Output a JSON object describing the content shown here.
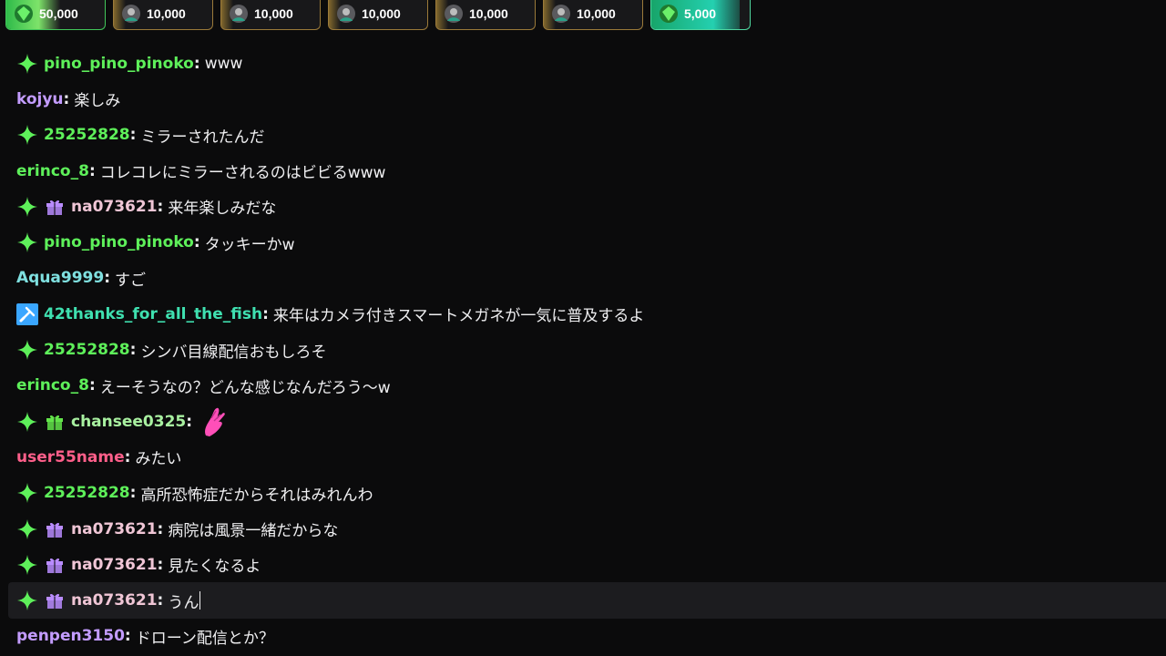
{
  "leaderboard": [
    {
      "amount": "50,000",
      "icon": "green-gem-avatar-icon",
      "fill_ratio": 0.55
    },
    {
      "amount": "10,000",
      "icon": "avatar-icon",
      "fill_ratio": 0.12
    },
    {
      "amount": "10,000",
      "icon": "avatar-icon",
      "fill_ratio": 0.12
    },
    {
      "amount": "10,000",
      "icon": "avatar-icon",
      "fill_ratio": 0.12
    },
    {
      "amount": "10,000",
      "icon": "avatar-icon",
      "fill_ratio": 0.12
    },
    {
      "amount": "10,000",
      "icon": "avatar-icon",
      "fill_ratio": 0.12
    },
    {
      "amount": "5,000",
      "icon": "green-gem-avatar-icon",
      "fill_ratio": 0.9
    }
  ],
  "colors": {
    "background": "#0b0b0c",
    "green": "#5ef05a",
    "purple": "#c39cff",
    "cyan": "#7fe0e0",
    "pink": "#ff5fa8",
    "gift_purple": "#b98cff",
    "gift_green": "#63e44a",
    "badge_green": "#5ef05a",
    "mod_blue": "#3aa6ff"
  },
  "chat": {
    "messages": [
      {
        "user": "pino_pino_pinoko",
        "color": "#5ef05a",
        "badges": [
          "sparkle-badge-icon"
        ],
        "text": "www"
      },
      {
        "user": "kojyu",
        "color": "#c39cff",
        "badges": [],
        "text": "楽しみ"
      },
      {
        "user": "25252828",
        "color": "#5ef05a",
        "badges": [
          "sparkle-badge-icon"
        ],
        "text": "ミラーされたんだ"
      },
      {
        "user": "erinco_8",
        "color": "#5ef05a",
        "badges": [],
        "text": "コレコレにミラーされるのはビビるwww"
      },
      {
        "user": "na073621",
        "color": "#f0c6d6",
        "badges": [
          "sparkle-badge-icon",
          "gift-purple-badge-icon"
        ],
        "text": "来年楽しみだな"
      },
      {
        "user": "pino_pino_pinoko",
        "color": "#5ef05a",
        "badges": [
          "sparkle-badge-icon"
        ],
        "text": "タッキーかw"
      },
      {
        "user": "Aqua9999",
        "color": "#7fe0e0",
        "badges": [],
        "text": "すご"
      },
      {
        "user": "42thanks_for_all_the_fish",
        "color": "#3fe0b0",
        "badges": [
          "moderator-sword-badge-icon"
        ],
        "text": "来年はカメラ付きスマートメガネが一気に普及するよ"
      },
      {
        "user": "25252828",
        "color": "#5ef05a",
        "badges": [
          "sparkle-badge-icon"
        ],
        "text": "シンバ目線配信おもしろそ"
      },
      {
        "user": "erinco_8",
        "color": "#5ef05a",
        "badges": [],
        "text": "えーそうなの？どんな感じなんだろう〜w"
      },
      {
        "user": "chansee0325",
        "color": "#a8f0a0",
        "badges": [
          "sparkle-badge-icon",
          "gift-green-badge-icon"
        ],
        "text": "",
        "emote": "praying-hands-emote-icon"
      },
      {
        "user": "user55name",
        "color": "#ff5f8a",
        "badges": [],
        "text": "みたい"
      },
      {
        "user": "25252828",
        "color": "#5ef05a",
        "badges": [
          "sparkle-badge-icon"
        ],
        "text": "高所恐怖症だからそれはみれんわ"
      },
      {
        "user": "na073621",
        "color": "#f0c6d6",
        "badges": [
          "sparkle-badge-icon",
          "gift-purple-badge-icon"
        ],
        "text": "病院は風景一緒だからな"
      },
      {
        "user": "na073621",
        "color": "#f0c6d6",
        "badges": [
          "sparkle-badge-icon",
          "gift-purple-badge-icon"
        ],
        "text": "見たくなるよ"
      },
      {
        "user": "na073621",
        "color": "#f0c6d6",
        "badges": [
          "sparkle-badge-icon",
          "gift-purple-badge-icon"
        ],
        "text": "うん",
        "highlighted": true
      },
      {
        "user": "penpen3150",
        "color": "#c39cff",
        "badges": [],
        "text": "ドローン配信とか？"
      }
    ]
  }
}
